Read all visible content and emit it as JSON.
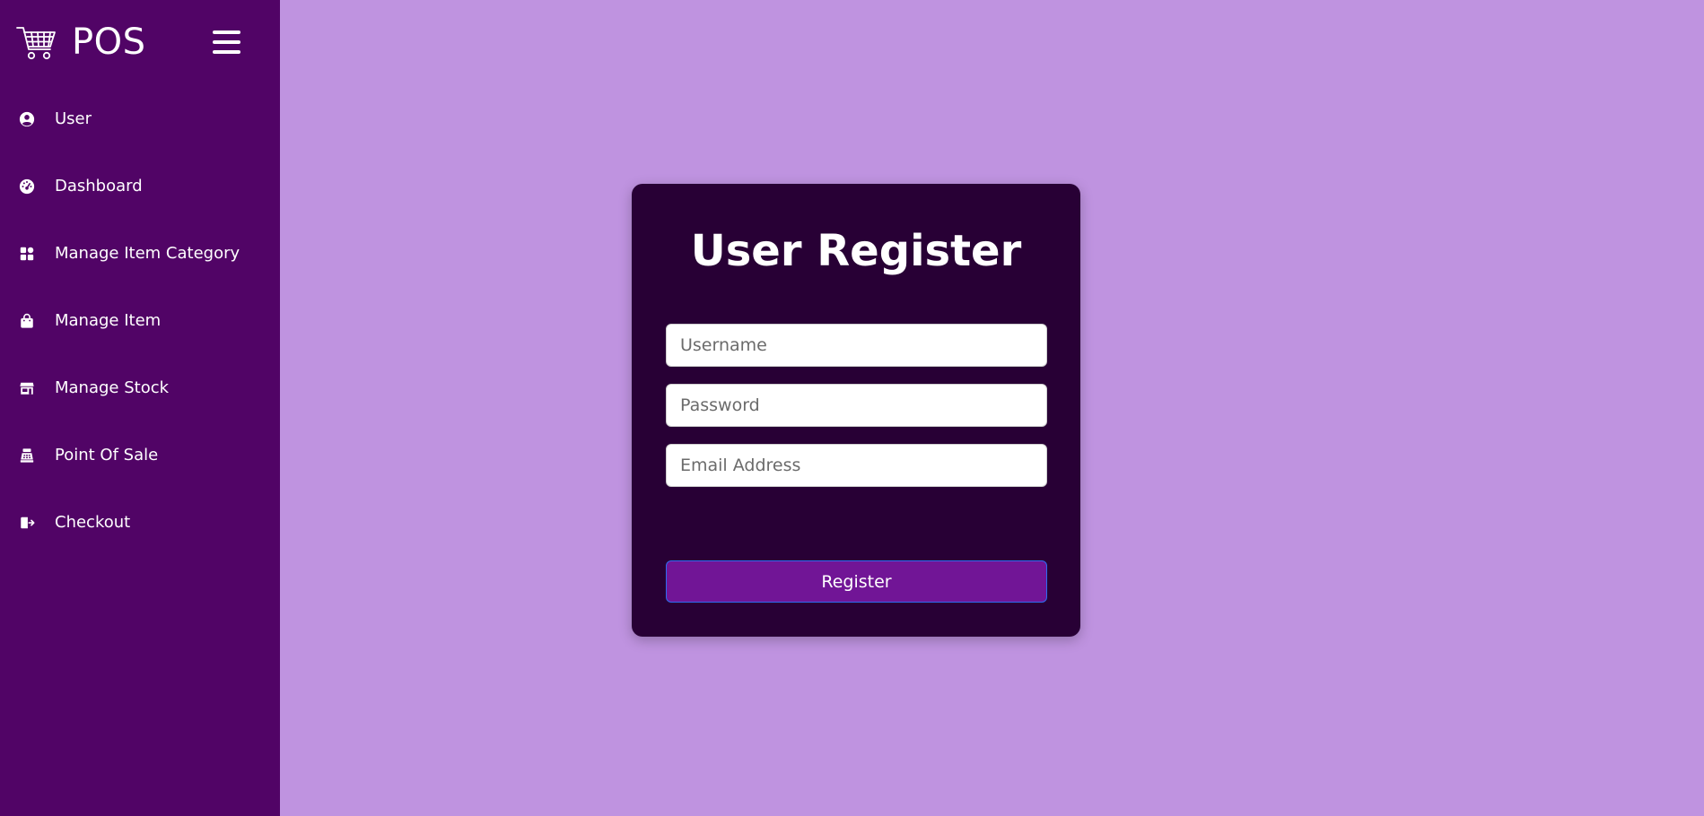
{
  "sidebar": {
    "brand": {
      "text": "POS",
      "icon": "cart-icon"
    },
    "toggle_icon": "hamburger-icon",
    "items": [
      {
        "label": "User",
        "icon": "user-circle-icon"
      },
      {
        "label": "Dashboard",
        "icon": "gauge-icon"
      },
      {
        "label": "Manage Item Category",
        "icon": "grid-icon"
      },
      {
        "label": "Manage Item",
        "icon": "shopping-bag-icon"
      },
      {
        "label": "Manage Stock",
        "icon": "store-icon"
      },
      {
        "label": "Point Of Sale",
        "icon": "cash-register-icon"
      },
      {
        "label": "Checkout",
        "icon": "sign-out-icon"
      }
    ]
  },
  "form": {
    "title": "User Register",
    "username_placeholder": "Username",
    "password_placeholder": "Password",
    "email_placeholder": "Email Address",
    "submit_label": "Register"
  },
  "colors": {
    "page_background": "#bf93e0",
    "sidebar_background": "#510466",
    "card_background": "#280035",
    "button_background": "#711596",
    "button_border": "#2d6cf0"
  }
}
